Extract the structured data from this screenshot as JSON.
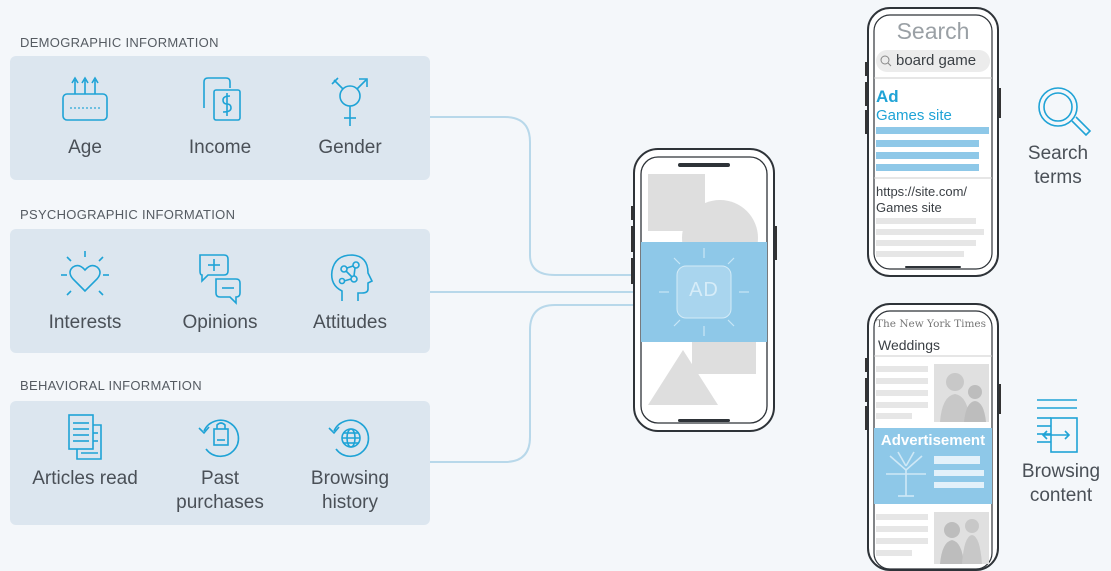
{
  "sections": [
    {
      "title": "DEMOGRAPHIC INFORMATION",
      "items": [
        {
          "label": "Age",
          "icon": "router-icon"
        },
        {
          "label": "Income",
          "icon": "money-icon"
        },
        {
          "label": "Gender",
          "icon": "gender-icon"
        }
      ]
    },
    {
      "title": "PSYCHOGRAPHIC INFORMATION",
      "items": [
        {
          "label": "Interests",
          "icon": "heart-icon"
        },
        {
          "label": "Opinions",
          "icon": "chat-icon"
        },
        {
          "label": "Attitudes",
          "icon": "head-network-icon"
        }
      ]
    },
    {
      "title": "BEHAVIORAL INFORMATION",
      "items": [
        {
          "label": "Articles read",
          "icon": "articles-icon"
        },
        {
          "label": "Past purchases",
          "icon": "bag-history-icon"
        },
        {
          "label": "Browsing history",
          "icon": "globe-history-icon"
        }
      ]
    }
  ],
  "center_phone": {
    "ad_label": "AD"
  },
  "search_phone": {
    "header": "Search",
    "query": "board game",
    "ad_tag": "Ad",
    "ad_title": "Games site",
    "result_url": "https://site.com/",
    "result_title": "Games site"
  },
  "news_phone": {
    "masthead": "The New York Times",
    "section": "Weddings",
    "ad_banner": "Advertisement"
  },
  "right_labels": {
    "search_terms": "Search terms",
    "browsing_content": "Browsing content"
  },
  "colors": {
    "accent": "#1fa3d6",
    "ad_blue": "#8ec8e8",
    "panel": "#dce6ef",
    "connector": "#b8d8ea"
  }
}
